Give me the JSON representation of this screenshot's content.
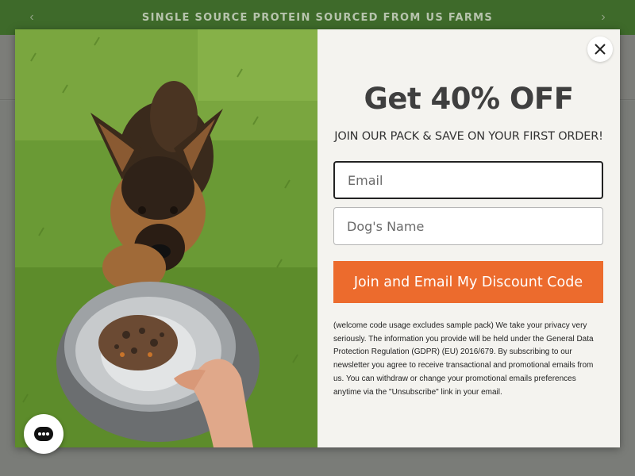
{
  "announcement": {
    "text": "SINGLE SOURCE PROTEIN SOURCED FROM US FARMS",
    "prev_icon": "chevron-left-icon",
    "next_icon": "chevron-right-icon"
  },
  "popup": {
    "headline": "Get 40% OFF",
    "subheadline": "JOIN OUR PACK & SAVE ON YOUR FIRST ORDER!",
    "email_placeholder": "Email",
    "email_value": "",
    "dog_name_placeholder": "Dog's Name",
    "dog_name_value": "",
    "submit_label": "Join and Email My Discount Code",
    "disclaimer": "(welcome code usage excludes sample pack) We take your privacy very seriously. The information you provide will be held under the General Data Protection Regulation (GDPR) (EU) 2016/679. By subscribing to our newsletter you agree to receive transactional and promotional emails from us. You can withdraw or change your promotional emails preferences anytime via the \"Unsubscribe\" link in your email.",
    "close_icon": "close-icon",
    "image_subject": "german-shepherd-with-food-bowl"
  },
  "chat": {
    "icon": "chat-icon"
  },
  "colors": {
    "announcement_bg": "#3e6a2a",
    "cta": "#ec6b2d",
    "headline": "#3f3f3f",
    "modal_bg": "#f4f3ef"
  }
}
